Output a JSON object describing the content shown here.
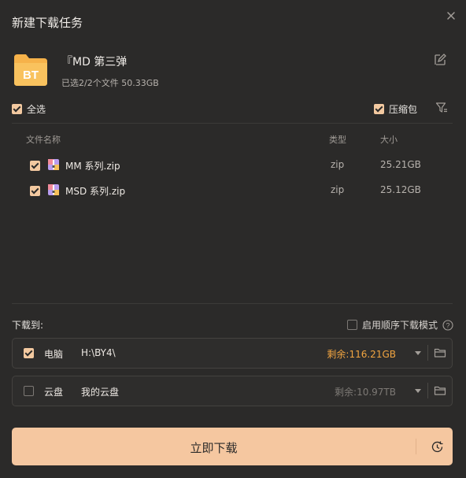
{
  "dialog": {
    "title": "新建下载任务",
    "close_icon": "close-icon"
  },
  "task": {
    "icon_text": "BT",
    "name": "『MD 第三弹",
    "info": "已选2/2个文件 50.33GB"
  },
  "options": {
    "select_all": "全选",
    "compress": "压缩包"
  },
  "table": {
    "headers": {
      "name": "文件名称",
      "type": "类型",
      "size": "大小"
    },
    "rows": [
      {
        "name": "MM 系列.zip",
        "type": "zip",
        "size": "25.21GB",
        "checked": true
      },
      {
        "name": "MSD 系列.zip",
        "type": "zip",
        "size": "25.12GB",
        "checked": true
      }
    ]
  },
  "download_to": {
    "label": "下载到:",
    "sequential": "启用顺序下载模式"
  },
  "destinations": [
    {
      "label": "电脑",
      "path": "H:\\BY4\\",
      "free": "剩余:116.21GB",
      "checked": true,
      "free_color": "#f2a541"
    },
    {
      "label": "云盘",
      "path": "我的云盘",
      "free": "剩余:10.97TB",
      "checked": false,
      "free_color": "#7d7975"
    }
  ],
  "action": {
    "download_now": "立即下载"
  }
}
